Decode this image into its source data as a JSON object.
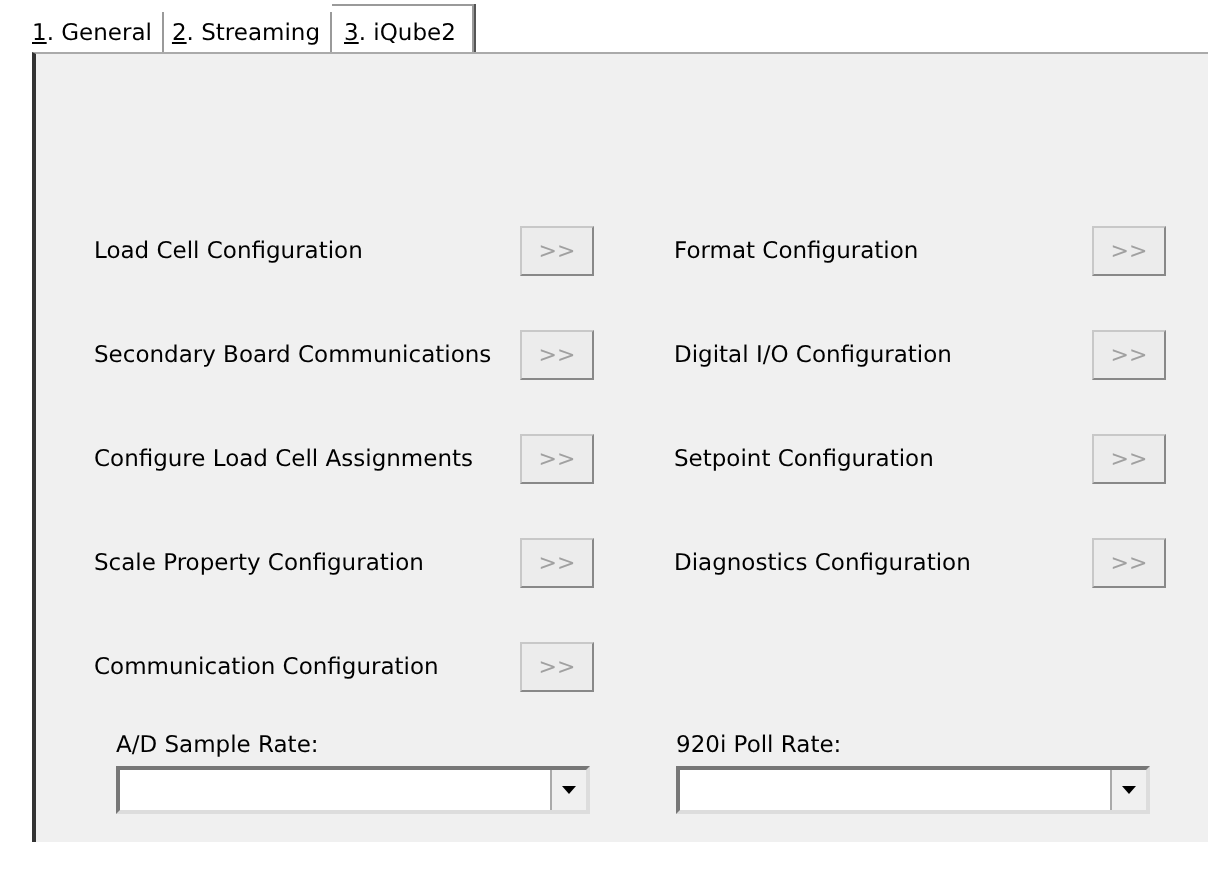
{
  "tabs": [
    {
      "label": "1. General",
      "selected": false
    },
    {
      "label": "2. Streaming",
      "selected": false
    },
    {
      "label": "3. iQube2",
      "selected": true
    }
  ],
  "config_columns": [
    {
      "items": [
        {
          "label": "Load Cell Configuration",
          "button": ">>",
          "disabled": true
        },
        {
          "label": "Secondary Board Communications",
          "button": ">>",
          "disabled": true
        },
        {
          "label": "Configure Load Cell Assignments",
          "button": ">>",
          "disabled": true
        },
        {
          "label": "Scale Property Configuration",
          "button": ">>",
          "disabled": true
        },
        {
          "label": "Communication Configuration",
          "button": ">>",
          "disabled": true
        }
      ]
    },
    {
      "items": [
        {
          "label": "Format Configuration",
          "button": ">>",
          "disabled": true
        },
        {
          "label": "Digital I/O Configuration",
          "button": ">>",
          "disabled": true
        },
        {
          "label": "Setpoint Configuration",
          "button": ">>",
          "disabled": true
        },
        {
          "label": "Diagnostics Configuration",
          "button": ">>",
          "disabled": true
        }
      ]
    }
  ],
  "dropdowns": [
    {
      "label": "A/D Sample Rate:"
    },
    {
      "label": "920i Poll Rate:"
    }
  ]
}
